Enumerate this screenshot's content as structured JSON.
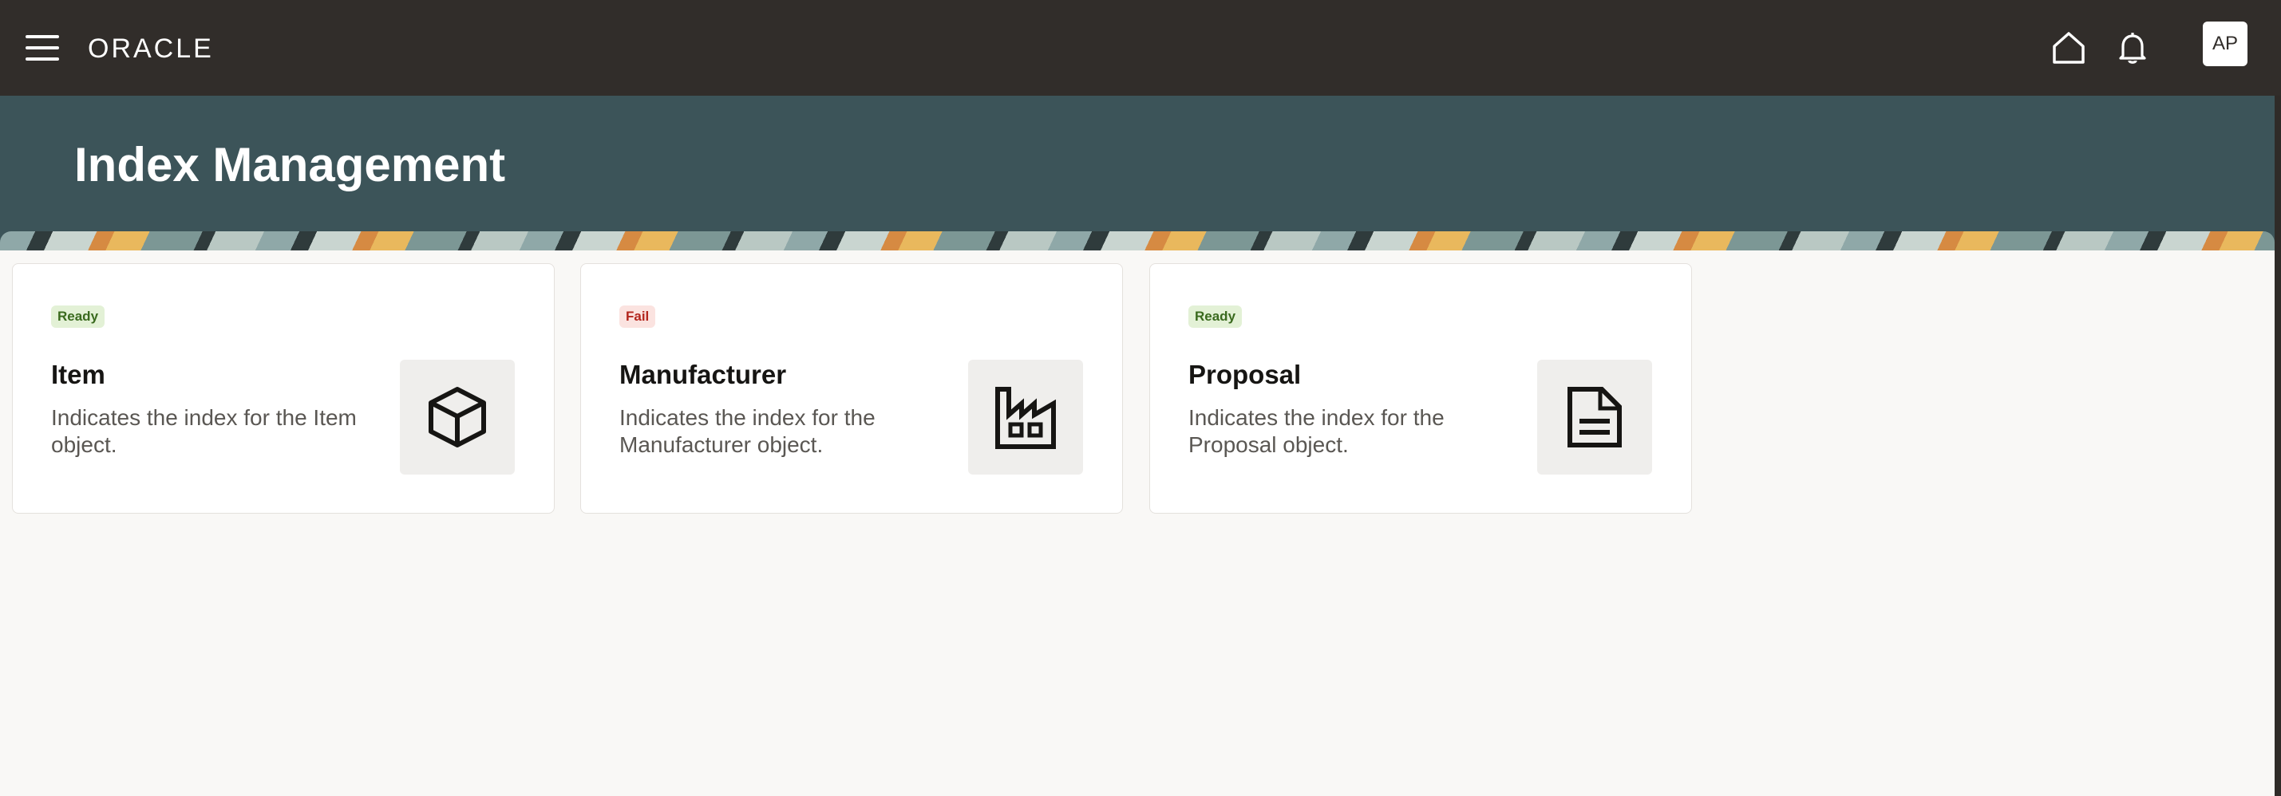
{
  "app": {
    "brand": "ORACLE",
    "user_initials": "AP"
  },
  "icons": {
    "menu": "hamburger-menu-icon",
    "home": "home-icon",
    "notifications": "bell-icon"
  },
  "page": {
    "title": "Index Management"
  },
  "cards": [
    {
      "status": "Ready",
      "status_color": "#3a6a1e",
      "title": "Item",
      "description": "Indicates the index for the Item object.",
      "icon": "cube-icon"
    },
    {
      "status": "Fail",
      "status_color": "#b3261e",
      "title": "Manufacturer",
      "description": "Indicates the index for the Manufacturer object.",
      "icon": "factory-icon"
    },
    {
      "status": "Ready",
      "status_color": "#3a6a1e",
      "title": "Proposal",
      "description": "Indicates the index for the Proposal object.",
      "icon": "document-icon"
    }
  ],
  "colors": {
    "topbar": "#312d2a",
    "header_band": "#3c5459",
    "page_background": "#f9f8f6"
  }
}
